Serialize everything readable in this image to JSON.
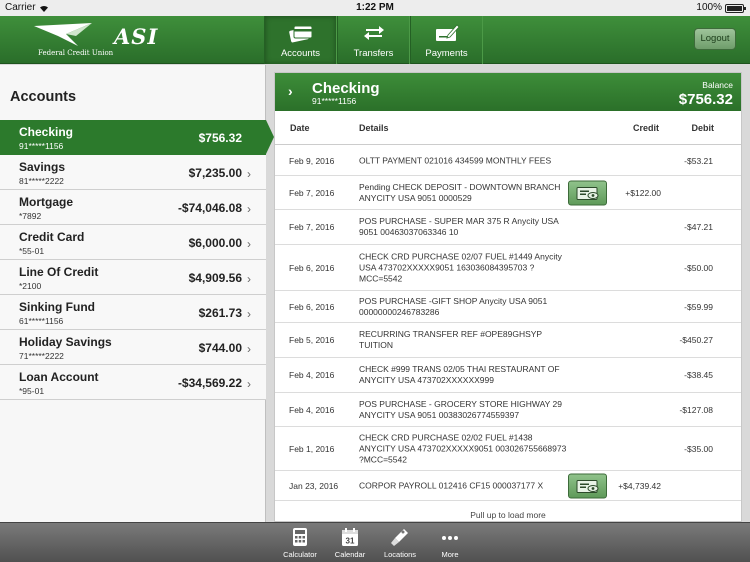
{
  "status_bar": {
    "carrier": "Carrier",
    "time": "1:22 PM",
    "battery": "100%"
  },
  "header": {
    "logo_text": "ASI",
    "logo_subtitle": "Federal Credit Union",
    "nav": [
      {
        "label": "Accounts",
        "icon": "cards-icon"
      },
      {
        "label": "Transfers",
        "icon": "transfer-arrows-icon"
      },
      {
        "label": "Payments",
        "icon": "check-pen-icon"
      }
    ],
    "logout_label": "Logout"
  },
  "sidebar": {
    "title": "Accounts",
    "accounts": [
      {
        "name": "Checking",
        "number": "91*****1156",
        "balance": "$756.32"
      },
      {
        "name": "Savings",
        "number": "81*****2222",
        "balance": "$7,235.00"
      },
      {
        "name": "Mortgage",
        "number": "*7892",
        "balance": "-$74,046.08"
      },
      {
        "name": "Credit Card",
        "number": "*55-01",
        "balance": "$6,000.00"
      },
      {
        "name": "Line Of Credit",
        "number": "*2100",
        "balance": "$4,909.56"
      },
      {
        "name": "Sinking Fund",
        "number": "61*****1156",
        "balance": "$261.73"
      },
      {
        "name": "Holiday Savings",
        "number": "71*****2222",
        "balance": "$744.00"
      },
      {
        "name": "Loan Account",
        "number": "*95-01",
        "balance": "-$34,569.22"
      }
    ]
  },
  "account_detail": {
    "name": "Checking",
    "number": "91*****1156",
    "balance_label": "Balance",
    "balance": "$756.32",
    "columns": {
      "date": "Date",
      "details": "Details",
      "credit": "Credit",
      "debit": "Debit"
    },
    "transactions": [
      {
        "date": "Feb 9, 2016",
        "details": "OLTT PAYMENT 021016 434599 MONTHLY FEES",
        "credit": "",
        "debit": "-$53.21",
        "has_image": false
      },
      {
        "date": "Feb 7, 2016",
        "details": "Pending CHECK DEPOSIT - DOWNTOWN BRANCH ANYCITY USA 9051 0000529",
        "credit": "+$122.00",
        "debit": "",
        "has_image": true
      },
      {
        "date": "Feb 7, 2016",
        "details": "POS PURCHASE -  SUPER MAR 375 R Anycity USA 9051 00463037063346 10",
        "credit": "",
        "debit": "-$47.21",
        "has_image": false
      },
      {
        "date": "Feb 6, 2016",
        "details": "CHECK CRD PURCHASE 02/07  FUEL #1449 Anycity USA 473702XXXXX9051 163036084395703 ?MCC=5542",
        "credit": "",
        "debit": "-$50.00",
        "has_image": false
      },
      {
        "date": "Feb 6, 2016",
        "details": "POS PURCHASE -GIFT SHOP Anycity USA 9051 00000000246783286",
        "credit": "",
        "debit": "-$59.99",
        "has_image": false
      },
      {
        "date": "Feb 5, 2016",
        "details": "RECURRING TRANSFER REF #OPE89GHSYP TUITION",
        "credit": "",
        "debit": "-$450.27",
        "has_image": false
      },
      {
        "date": "Feb 4, 2016",
        "details": "CHECK #999 TRANS 02/05 THAI RESTAURANT OF ANYCITY USA 473702XXXXXX999",
        "credit": "",
        "debit": "-$38.45",
        "has_image": false
      },
      {
        "date": "Feb 4, 2016",
        "details": "POS PURCHASE - GROCERY STORE HIGHWAY 29 ANYCITY USA 9051 00383026774559397",
        "credit": "",
        "debit": "-$127.08",
        "has_image": false
      },
      {
        "date": "Feb 1, 2016",
        "details": "CHECK CRD PURCHASE 02/02 FUEL #1438 ANYCITY USA 473702XXXXX9051 003026755668973 ?MCC=5542",
        "credit": "",
        "debit": "-$35.00",
        "has_image": false
      },
      {
        "date": "Jan 23, 2016",
        "details": "CORPOR PAYROLL 012416 CF15 000037177 X",
        "credit": "+$4,739.42",
        "debit": "",
        "has_image": true
      }
    ],
    "pull_up_text": "Pull up to load more"
  },
  "tab_bar": [
    {
      "label": "Calculator",
      "icon": "calculator-icon"
    },
    {
      "label": "Calendar",
      "icon": "calendar-icon",
      "day": "31"
    },
    {
      "label": "Locations",
      "icon": "map-pin-icon"
    },
    {
      "label": "More",
      "icon": "more-dots-icon"
    }
  ]
}
